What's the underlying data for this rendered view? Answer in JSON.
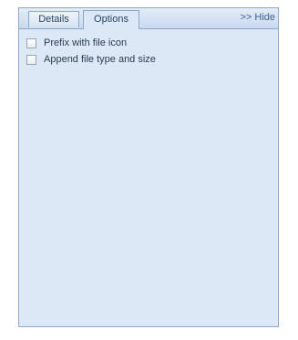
{
  "tabs": {
    "details": "Details",
    "options": "Options",
    "active": "Options"
  },
  "hide_link": ">> Hide",
  "options": [
    {
      "label": "Prefix with file icon",
      "checked": false
    },
    {
      "label": "Append file type and size",
      "checked": false
    }
  ],
  "colors": {
    "panel_bg": "#dce8f6",
    "border": "#8fa7c9",
    "text": "#2b3b52"
  }
}
